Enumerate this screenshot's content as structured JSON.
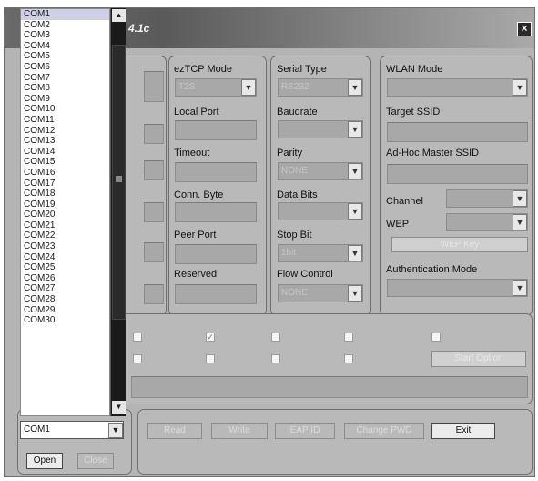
{
  "window": {
    "title_fragment": "4.1c",
    "close_glyph": "×"
  },
  "ezTCP": {
    "mode_label": "ezTCP Mode",
    "mode_value": "T2S",
    "local_port_label": "Local Port",
    "timeout_label": "Timeout",
    "conn_byte_label": "Conn. Byte",
    "peer_port_label": "Peer Port",
    "reserved_label": "Reserved"
  },
  "serial": {
    "type_label": "Serial Type",
    "type_value": "RS232",
    "baudrate_label": "Baudrate",
    "parity_label": "Parity",
    "parity_value": "NONE",
    "data_bits_label": "Data Bits",
    "stop_bit_label": "Stop Bit",
    "stop_bit_value": "1bit",
    "flow_control_label": "Flow Control",
    "flow_control_value": "NONE"
  },
  "wlan": {
    "mode_label": "WLAN Mode",
    "target_ssid_label": "Target SSID",
    "adhoc_label": "Ad-Hoc Master SSID",
    "channel_label": "Channel",
    "wep_label": "WEP",
    "wep_key_button": "WEP Key",
    "auth_mode_label": "Authentication Mode"
  },
  "options": {
    "start_option_button": "Start Option"
  },
  "com_port": {
    "items": [
      "COM1",
      "COM2",
      "COM3",
      "COM4",
      "COM5",
      "COM6",
      "COM7",
      "COM8",
      "COM9",
      "COM10",
      "COM11",
      "COM12",
      "COM13",
      "COM14",
      "COM15",
      "COM16",
      "COM17",
      "COM18",
      "COM19",
      "COM20",
      "COM21",
      "COM22",
      "COM23",
      "COM24",
      "COM25",
      "COM26",
      "COM27",
      "COM28",
      "COM29",
      "COM30"
    ],
    "selected": "COM1",
    "open_button": "Open",
    "close_button": "Close"
  },
  "actions": {
    "read": "Read",
    "write": "Write",
    "eap_id": "EAP ID",
    "change_pwd": "Change PWD",
    "exit": "Exit"
  },
  "icons": {
    "dropdown": "chevron-down-icon",
    "scroll_up": "chevron-up-icon",
    "scroll_down": "chevron-down-icon",
    "checkbox_checked": "check-icon"
  }
}
